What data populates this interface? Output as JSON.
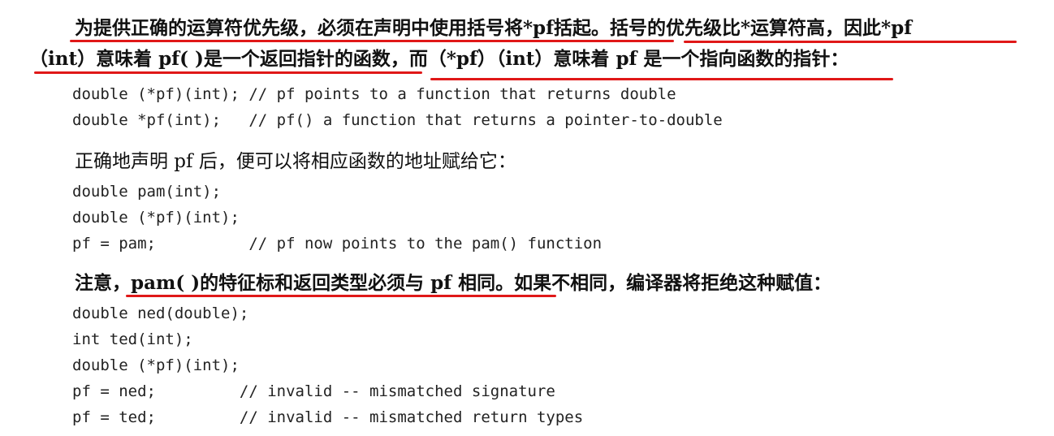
{
  "paragraph1": {
    "line1_part1": "为提供正确的运算符优先级，必须在声明中使用括号将*pf括起。",
    "line1_part2": "括号的优先级比*运算符高，因此*pf",
    "line2_part1": "（int）意味着 pf( )是一个返回指针的函数，",
    "line2_part2": "而（*pf）（int）意味着 pf 是一个指向函数的指针："
  },
  "code_block_1": [
    "double (*pf)(int); // pf points to a function that returns double",
    "double *pf(int);   // pf() a function that returns a pointer-to-double"
  ],
  "paragraph2": "正确地声明 pf 后，便可以将相应函数的地址赋给它：",
  "code_block_2": [
    "double pam(int);",
    "double (*pf)(int);",
    "pf = pam;          // pf now points to the pam() function"
  ],
  "paragraph3": {
    "part1": "注意，",
    "part2": "pam( )的特征标和返回类型必须与 pf 相同。",
    "part3": "如果不相同，编译器将拒绝这种赋值："
  },
  "code_block_3": [
    "double ned(double);",
    "int ted(int);",
    "double (*pf)(int);",
    "pf = ned;         // invalid -- mismatched signature",
    "pf = ted;         // invalid -- mismatched return types"
  ],
  "colors": {
    "underline": "#e01818",
    "text": "#111111"
  }
}
